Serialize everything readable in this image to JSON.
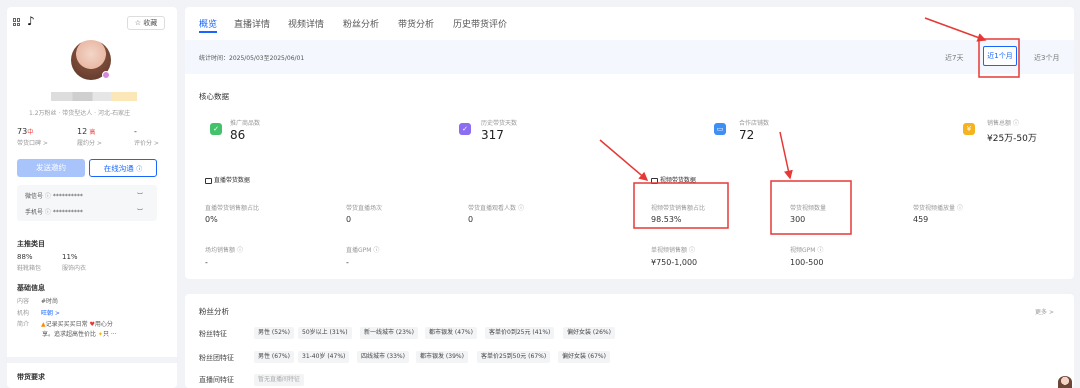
{
  "left": {
    "collect": "收藏",
    "fans_info": "1.2万粉丝 · 带货型达人 · 河北-石家庄",
    "stats": [
      {
        "value": "73",
        "badge": "中",
        "label": "带货口碑"
      },
      {
        "value": "12",
        "badge": "高",
        "label": "履约分"
      },
      {
        "value": "-",
        "badge": "",
        "label": "评价分"
      }
    ],
    "send_invite": "发送邀约",
    "online_chat": "在线沟通",
    "wechat_label": "微信号",
    "phone_label": "手机号",
    "masked": "**********",
    "category_title": "主推类目",
    "categories": [
      {
        "pct": "88%",
        "name": "鞋靴箱包"
      },
      {
        "pct": "11%",
        "name": "服饰内衣"
      }
    ],
    "basic_title": "基础信息",
    "content_label": "内容",
    "content_value": "#时尚",
    "org_label": "机构",
    "org_value": "旺朝",
    "intro_label": "简介",
    "intro_line1": "记录买买买日常",
    "intro_line1b": "用心分",
    "intro_line2": "享。追求超高性价比",
    "intro_line2b": "只 ···",
    "requirement_title": "带货要求"
  },
  "tabs": [
    "概览",
    "直播详情",
    "视频详情",
    "粉丝分析",
    "带货分析",
    "历史带货评价"
  ],
  "period": {
    "range_text": "统计时间：2025/05/03至2025/06/01",
    "options": [
      "近7天",
      "近1个月",
      "近3个月"
    ]
  },
  "core": {
    "title": "核心数据",
    "items": [
      {
        "label": "推广商品数",
        "value": "86"
      },
      {
        "label": "历史带货天数",
        "value": "317"
      },
      {
        "label": "合作店铺数",
        "value": "72"
      },
      {
        "label": "销售总额",
        "value": "¥25万-50万"
      }
    ]
  },
  "live": {
    "title": "直播带货数据",
    "metrics": [
      {
        "label": "直播带货销售额占比",
        "value": "0%"
      },
      {
        "label": "带货直播场次",
        "value": "0"
      },
      {
        "label": "带货直播观看人数",
        "value": "0"
      },
      {
        "label": "场均销售额",
        "value": "-"
      },
      {
        "label": "直播GPM",
        "value": "-"
      }
    ]
  },
  "video": {
    "title": "视频带货数据",
    "metrics": [
      {
        "label": "视频带货销售额占比",
        "value": "98.53%"
      },
      {
        "label": "带货视频数量",
        "value": "300"
      },
      {
        "label": "带货视频播放量",
        "value": "459"
      },
      {
        "label": "单视频销售额",
        "value": "¥750-1,000"
      },
      {
        "label": "视频GPM",
        "value": "100-500"
      }
    ]
  },
  "fans": {
    "title": "粉丝分析",
    "more": "更多",
    "rows": [
      {
        "label": "粉丝特征",
        "tags": [
          "男性 (52%)",
          "50岁以上 (31%)",
          "新一线城市 (23%)",
          "都市银发 (47%)",
          "客单价0到25元 (41%)",
          "偏好女装 (26%)"
        ]
      },
      {
        "label": "粉丝团特征",
        "tags": [
          "男性 (67%)",
          "31-40岁 (47%)",
          "四线城市 (33%)",
          "都市银发 (39%)",
          "客单价25到50元 (67%)",
          "偏好女装 (67%)"
        ]
      },
      {
        "label": "直播间特征",
        "tags": [
          "暂无直播间特征"
        ]
      }
    ]
  },
  "colors": {
    "accent": "#1966ff",
    "highlight": "#e53935"
  }
}
